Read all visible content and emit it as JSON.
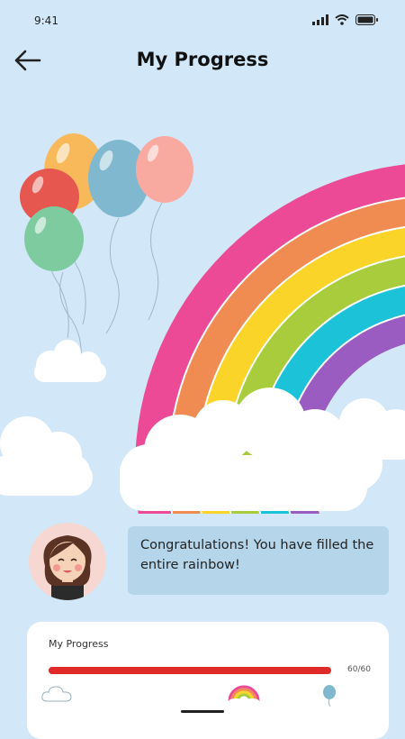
{
  "status": {
    "time": "9:41"
  },
  "header": {
    "title": "My Progress"
  },
  "message": {
    "text": "Congratulations! You have filled the entire rainbow!"
  },
  "progress": {
    "label": "My Progress",
    "current": 60,
    "total": 60,
    "count_text": "60/60",
    "fraction": 1.0,
    "fill_color": "#e02a2a"
  },
  "colors": {
    "background": "#d2e8f8",
    "rainbow": [
      "#ec4a96",
      "#f08c52",
      "#fbd42a",
      "#a8cc3c",
      "#1cc2d8",
      "#9a5cc0"
    ],
    "balloons": [
      "#f7b95a",
      "#e5574f",
      "#80b9cf",
      "#f9aaa0",
      "#7ecba0"
    ]
  },
  "milestones": [
    "cloud-icon",
    "rainbow-icon",
    "balloon-icon"
  ]
}
